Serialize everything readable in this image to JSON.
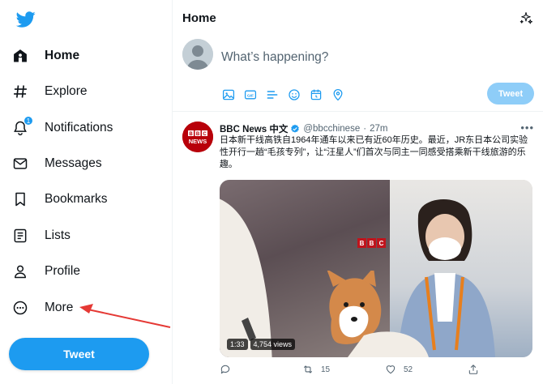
{
  "sidebar": {
    "logo": "twitter-bird-icon",
    "items": [
      {
        "label": "Home",
        "icon": "home-icon",
        "active": true
      },
      {
        "label": "Explore",
        "icon": "hashtag-icon"
      },
      {
        "label": "Notifications",
        "icon": "bell-icon",
        "badge": "1"
      },
      {
        "label": "Messages",
        "icon": "envelope-icon"
      },
      {
        "label": "Bookmarks",
        "icon": "bookmark-icon"
      },
      {
        "label": "Lists",
        "icon": "list-icon"
      },
      {
        "label": "Profile",
        "icon": "person-icon"
      },
      {
        "label": "More",
        "icon": "more-circle-icon"
      }
    ],
    "tweet_button": "Tweet"
  },
  "header": {
    "title": "Home",
    "sparkle_icon": "sparkle-icon"
  },
  "compose": {
    "placeholder": "What’s happening?",
    "icons": [
      "image-icon",
      "gif-icon",
      "poll-icon",
      "emoji-icon",
      "schedule-icon",
      "location-icon"
    ],
    "button": "Tweet"
  },
  "tweet": {
    "avatar_text": [
      "BBC",
      "NEWS"
    ],
    "name": "BBC News 中文",
    "handle": "@bbcchinese",
    "separator": "·",
    "time": "27m",
    "text": "日本新干线高铁自1964年通车以来已有近60年历史。最近，JR东日本公司实验性开行一趟“毛孩专列”，让“汪星人”们首次与同主一同感受搭乘新干线旅游的乐趣。",
    "media": {
      "sign": [
        "B",
        "B",
        "C"
      ],
      "duration": "1:33",
      "views": "4,754 views"
    },
    "actions": {
      "reply": "",
      "retweet": "15",
      "like": "52"
    }
  },
  "colors": {
    "accent": "#1d9bf0",
    "accent_disabled": "#8ecdf8",
    "text": "#0f1419",
    "muted": "#536471",
    "annotation_arrow": "#e53935"
  }
}
